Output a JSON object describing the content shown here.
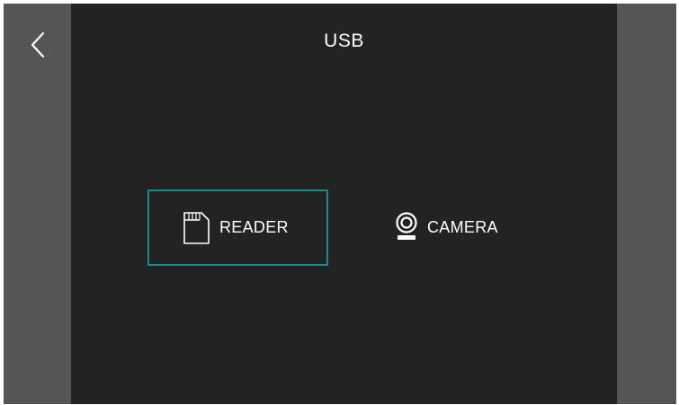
{
  "screen": {
    "title": "USB",
    "back_icon": "chevron-left-icon"
  },
  "options": [
    {
      "label": "READER",
      "icon": "sd-card-icon",
      "selected": true
    },
    {
      "label": "CAMERA",
      "icon": "webcam-icon",
      "selected": false
    }
  ],
  "colors": {
    "background": "#232323",
    "side_panels": "#555555",
    "selection_border": "#1b8a8f",
    "text": "#ffffff"
  }
}
